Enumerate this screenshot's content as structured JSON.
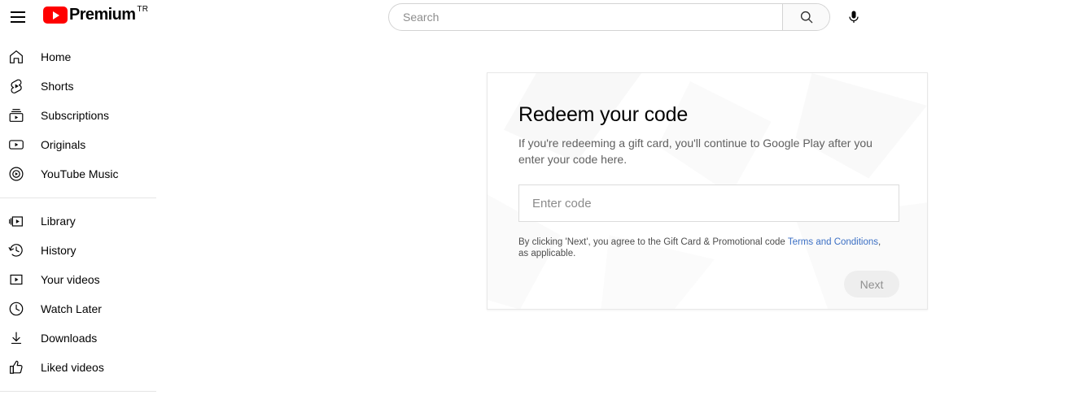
{
  "topbar": {
    "menu_icon": "hamburger-menu-icon",
    "logo": {
      "brand": "Premium",
      "country_code": "TR",
      "play_icon": "youtube-play-icon",
      "brand_color": "#ff0000"
    },
    "search": {
      "placeholder": "Search",
      "value": "",
      "search_icon": "search-icon",
      "mic_icon": "microphone-icon"
    }
  },
  "sidebar": {
    "group1": [
      {
        "label": "Home",
        "icon": "home-icon"
      },
      {
        "label": "Shorts",
        "icon": "shorts-icon"
      },
      {
        "label": "Subscriptions",
        "icon": "subscriptions-icon"
      },
      {
        "label": "Originals",
        "icon": "originals-icon"
      },
      {
        "label": "YouTube Music",
        "icon": "youtube-music-icon"
      }
    ],
    "group2": [
      {
        "label": "Library",
        "icon": "library-icon"
      },
      {
        "label": "History",
        "icon": "history-icon"
      },
      {
        "label": "Your videos",
        "icon": "your-videos-icon"
      },
      {
        "label": "Watch Later",
        "icon": "watch-later-icon"
      },
      {
        "label": "Downloads",
        "icon": "downloads-icon"
      },
      {
        "label": "Liked videos",
        "icon": "liked-videos-icon"
      }
    ]
  },
  "card": {
    "title": "Redeem your code",
    "subtitle": "If you're redeeming a gift card, you'll continue to Google Play after you enter your code here.",
    "input": {
      "placeholder": "Enter code",
      "value": ""
    },
    "disclaimer_before": "By clicking 'Next', you agree to the Gift Card & Promotional code ",
    "disclaimer_link": "Terms and Conditions",
    "disclaimer_after": ", as applicable.",
    "link_color": "#3b6fc4",
    "next_button": {
      "label": "Next",
      "disabled": true,
      "bg_color": "#eeeeee",
      "text_color": "#909090"
    }
  }
}
